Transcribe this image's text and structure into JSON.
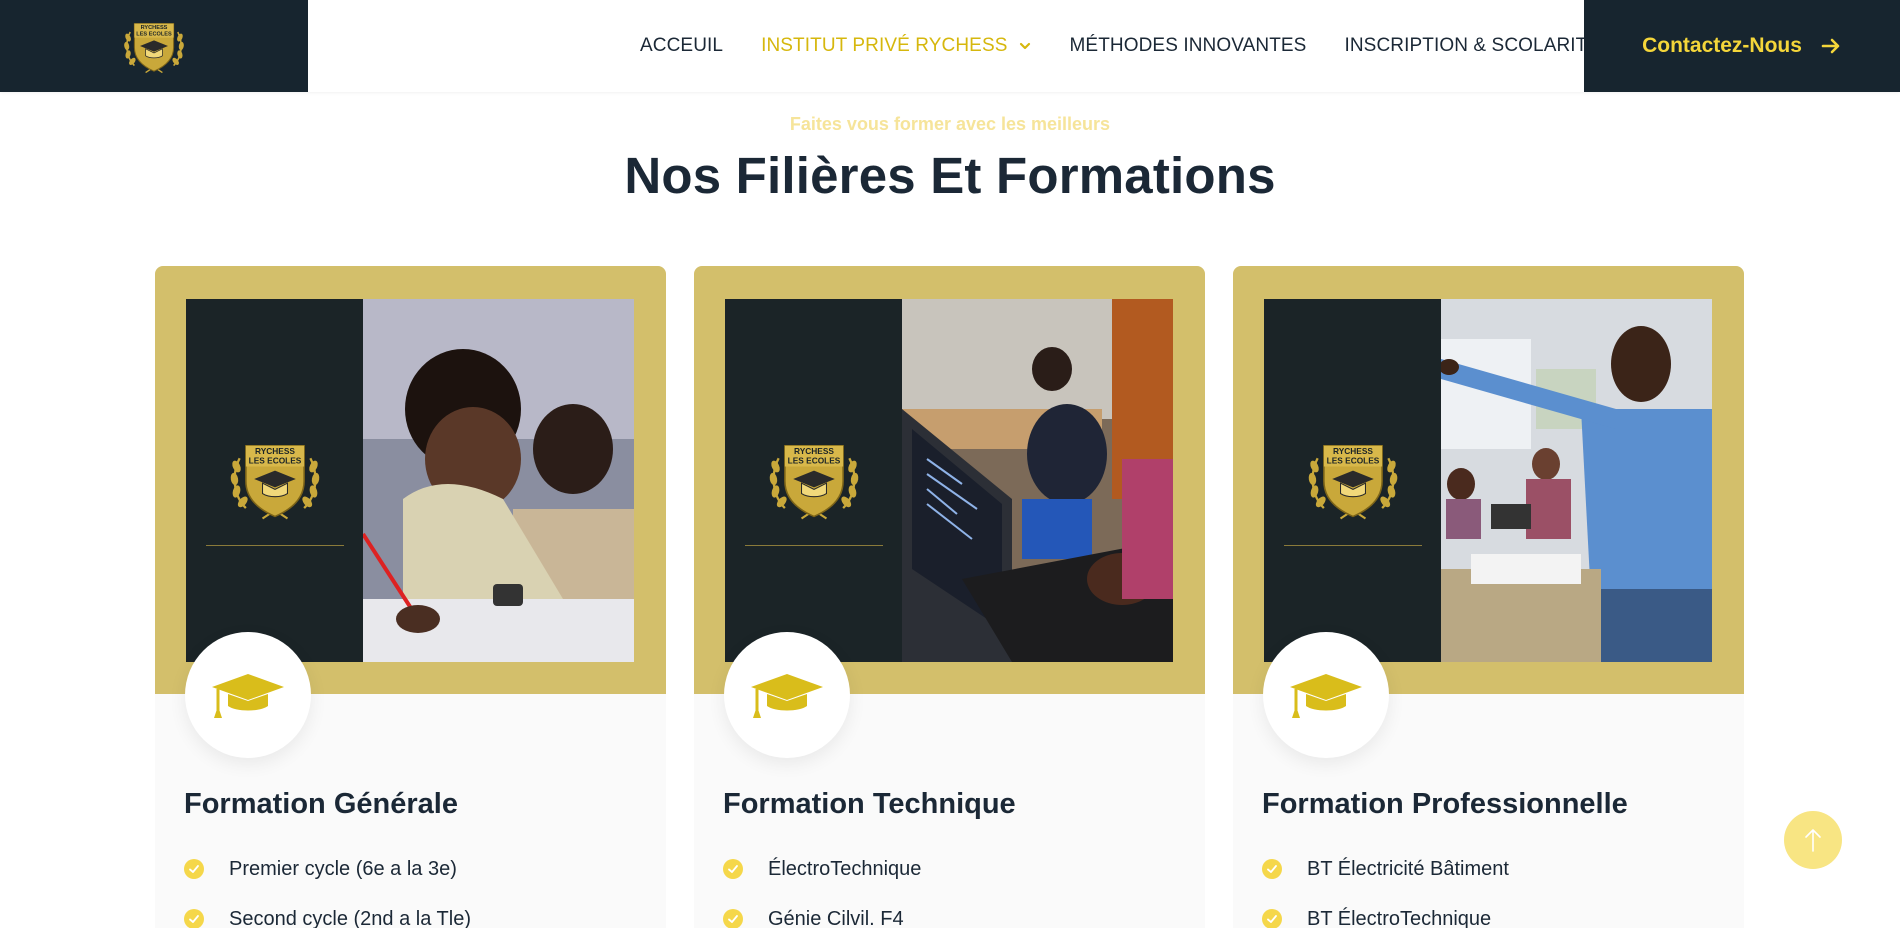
{
  "header": {
    "logo_text": [
      "RYCHESS",
      "LES ECOLES"
    ],
    "nav": [
      {
        "label": "ACCEUIL"
      },
      {
        "label": "INSTITUT PRIVÉ RYCHESS"
      },
      {
        "label": "MÉTHODES INNOVANTES"
      },
      {
        "label": "INSCRIPTION & SCOLARITÉ"
      }
    ],
    "cta_label": "Contactez-Nous"
  },
  "section": {
    "subtitle": "Faites vous former avec les meilleurs",
    "title": "Nos Filières Et Formations"
  },
  "cards": [
    {
      "title": "Formation Générale",
      "items": [
        "Premier cycle (6e a la 3e)",
        "Second cycle (2nd a la Tle)"
      ]
    },
    {
      "title": "Formation Technique",
      "items": [
        "ÉlectroTechnique",
        "Génie Cilvil. F4"
      ]
    },
    {
      "title": "Formation Professionnelle",
      "items": [
        "BT Électricité Bâtiment",
        "BT ÉlectroTechnique"
      ]
    }
  ],
  "colors": {
    "navy": "#17252f",
    "gold": "#d3bf6b",
    "accent_yellow": "#d6b70d",
    "cta_text": "#f4d63a"
  },
  "icons": {
    "logo": "school-crest-icon",
    "card_icon": "graduation-cap-icon",
    "check": "check-circle-icon",
    "cta": "arrow-right-icon",
    "scroll": "arrow-up-icon"
  }
}
